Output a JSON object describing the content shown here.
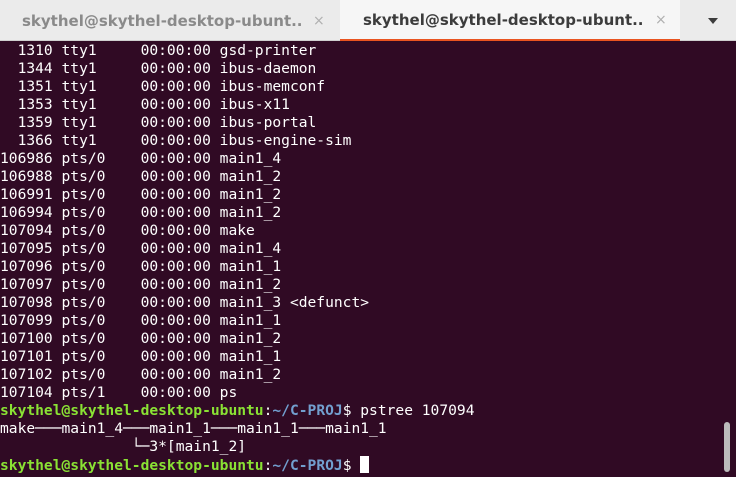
{
  "tabs": [
    {
      "title": "skythel@skythel-desktop-ubunt...",
      "close": "×"
    },
    {
      "title": "skythel@skythel-desktop-ubunt...",
      "close": "×"
    }
  ],
  "menu_icon": "chevron-down-icon",
  "colors": {
    "background": "#300a24",
    "user": "#8ae234",
    "path": "#729fcf",
    "accent": "#e95420"
  },
  "process_lines": [
    "  1310 tty1     00:00:00 gsd-printer",
    "  1344 tty1     00:00:00 ibus-daemon",
    "  1351 tty1     00:00:00 ibus-memconf",
    "  1353 tty1     00:00:00 ibus-x11",
    "  1359 tty1     00:00:00 ibus-portal",
    "  1366 tty1     00:00:00 ibus-engine-sim",
    "106986 pts/0    00:00:00 main1_4",
    "106988 pts/0    00:00:00 main1_2",
    "106991 pts/0    00:00:00 main1_2",
    "106994 pts/0    00:00:00 main1_2",
    "107094 pts/0    00:00:00 make",
    "107095 pts/0    00:00:00 main1_4",
    "107096 pts/0    00:00:00 main1_1",
    "107097 pts/0    00:00:00 main1_2",
    "107098 pts/0    00:00:00 main1_3 <defunct>",
    "107099 pts/0    00:00:00 main1_1",
    "107100 pts/0    00:00:00 main1_2",
    "107101 pts/0    00:00:00 main1_1",
    "107102 pts/0    00:00:00 main1_2",
    "107104 pts/1    00:00:00 ps"
  ],
  "prompt": {
    "user": "skythel@skythel-desktop-ubuntu",
    "sep": ":",
    "path": "~/C-PROJ",
    "dollar": "$ "
  },
  "command": "pstree 107094",
  "pstree_lines": [
    "make───main1_4───main1_1───main1_1───main1_1",
    "               └─3*[main1_2]"
  ]
}
